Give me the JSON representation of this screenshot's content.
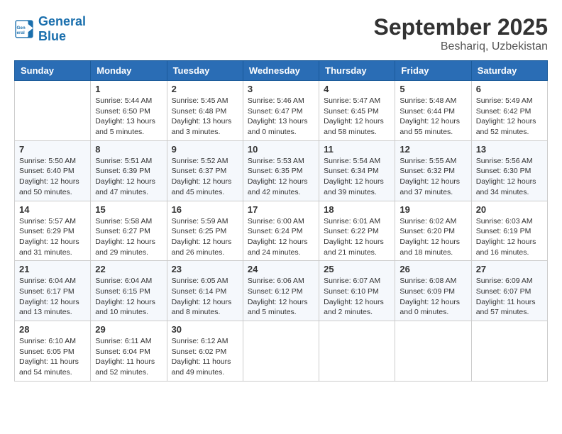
{
  "header": {
    "logo_line1": "General",
    "logo_line2": "Blue",
    "month_title": "September 2025",
    "location": "Beshariq, Uzbekistan"
  },
  "weekdays": [
    "Sunday",
    "Monday",
    "Tuesday",
    "Wednesday",
    "Thursday",
    "Friday",
    "Saturday"
  ],
  "weeks": [
    [
      {
        "day": "",
        "info": ""
      },
      {
        "day": "1",
        "info": "Sunrise: 5:44 AM\nSunset: 6:50 PM\nDaylight: 13 hours\nand 5 minutes."
      },
      {
        "day": "2",
        "info": "Sunrise: 5:45 AM\nSunset: 6:48 PM\nDaylight: 13 hours\nand 3 minutes."
      },
      {
        "day": "3",
        "info": "Sunrise: 5:46 AM\nSunset: 6:47 PM\nDaylight: 13 hours\nand 0 minutes."
      },
      {
        "day": "4",
        "info": "Sunrise: 5:47 AM\nSunset: 6:45 PM\nDaylight: 12 hours\nand 58 minutes."
      },
      {
        "day": "5",
        "info": "Sunrise: 5:48 AM\nSunset: 6:44 PM\nDaylight: 12 hours\nand 55 minutes."
      },
      {
        "day": "6",
        "info": "Sunrise: 5:49 AM\nSunset: 6:42 PM\nDaylight: 12 hours\nand 52 minutes."
      }
    ],
    [
      {
        "day": "7",
        "info": "Sunrise: 5:50 AM\nSunset: 6:40 PM\nDaylight: 12 hours\nand 50 minutes."
      },
      {
        "day": "8",
        "info": "Sunrise: 5:51 AM\nSunset: 6:39 PM\nDaylight: 12 hours\nand 47 minutes."
      },
      {
        "day": "9",
        "info": "Sunrise: 5:52 AM\nSunset: 6:37 PM\nDaylight: 12 hours\nand 45 minutes."
      },
      {
        "day": "10",
        "info": "Sunrise: 5:53 AM\nSunset: 6:35 PM\nDaylight: 12 hours\nand 42 minutes."
      },
      {
        "day": "11",
        "info": "Sunrise: 5:54 AM\nSunset: 6:34 PM\nDaylight: 12 hours\nand 39 minutes."
      },
      {
        "day": "12",
        "info": "Sunrise: 5:55 AM\nSunset: 6:32 PM\nDaylight: 12 hours\nand 37 minutes."
      },
      {
        "day": "13",
        "info": "Sunrise: 5:56 AM\nSunset: 6:30 PM\nDaylight: 12 hours\nand 34 minutes."
      }
    ],
    [
      {
        "day": "14",
        "info": "Sunrise: 5:57 AM\nSunset: 6:29 PM\nDaylight: 12 hours\nand 31 minutes."
      },
      {
        "day": "15",
        "info": "Sunrise: 5:58 AM\nSunset: 6:27 PM\nDaylight: 12 hours\nand 29 minutes."
      },
      {
        "day": "16",
        "info": "Sunrise: 5:59 AM\nSunset: 6:25 PM\nDaylight: 12 hours\nand 26 minutes."
      },
      {
        "day": "17",
        "info": "Sunrise: 6:00 AM\nSunset: 6:24 PM\nDaylight: 12 hours\nand 24 minutes."
      },
      {
        "day": "18",
        "info": "Sunrise: 6:01 AM\nSunset: 6:22 PM\nDaylight: 12 hours\nand 21 minutes."
      },
      {
        "day": "19",
        "info": "Sunrise: 6:02 AM\nSunset: 6:20 PM\nDaylight: 12 hours\nand 18 minutes."
      },
      {
        "day": "20",
        "info": "Sunrise: 6:03 AM\nSunset: 6:19 PM\nDaylight: 12 hours\nand 16 minutes."
      }
    ],
    [
      {
        "day": "21",
        "info": "Sunrise: 6:04 AM\nSunset: 6:17 PM\nDaylight: 12 hours\nand 13 minutes."
      },
      {
        "day": "22",
        "info": "Sunrise: 6:04 AM\nSunset: 6:15 PM\nDaylight: 12 hours\nand 10 minutes."
      },
      {
        "day": "23",
        "info": "Sunrise: 6:05 AM\nSunset: 6:14 PM\nDaylight: 12 hours\nand 8 minutes."
      },
      {
        "day": "24",
        "info": "Sunrise: 6:06 AM\nSunset: 6:12 PM\nDaylight: 12 hours\nand 5 minutes."
      },
      {
        "day": "25",
        "info": "Sunrise: 6:07 AM\nSunset: 6:10 PM\nDaylight: 12 hours\nand 2 minutes."
      },
      {
        "day": "26",
        "info": "Sunrise: 6:08 AM\nSunset: 6:09 PM\nDaylight: 12 hours\nand 0 minutes."
      },
      {
        "day": "27",
        "info": "Sunrise: 6:09 AM\nSunset: 6:07 PM\nDaylight: 11 hours\nand 57 minutes."
      }
    ],
    [
      {
        "day": "28",
        "info": "Sunrise: 6:10 AM\nSunset: 6:05 PM\nDaylight: 11 hours\nand 54 minutes."
      },
      {
        "day": "29",
        "info": "Sunrise: 6:11 AM\nSunset: 6:04 PM\nDaylight: 11 hours\nand 52 minutes."
      },
      {
        "day": "30",
        "info": "Sunrise: 6:12 AM\nSunset: 6:02 PM\nDaylight: 11 hours\nand 49 minutes."
      },
      {
        "day": "",
        "info": ""
      },
      {
        "day": "",
        "info": ""
      },
      {
        "day": "",
        "info": ""
      },
      {
        "day": "",
        "info": ""
      }
    ]
  ]
}
